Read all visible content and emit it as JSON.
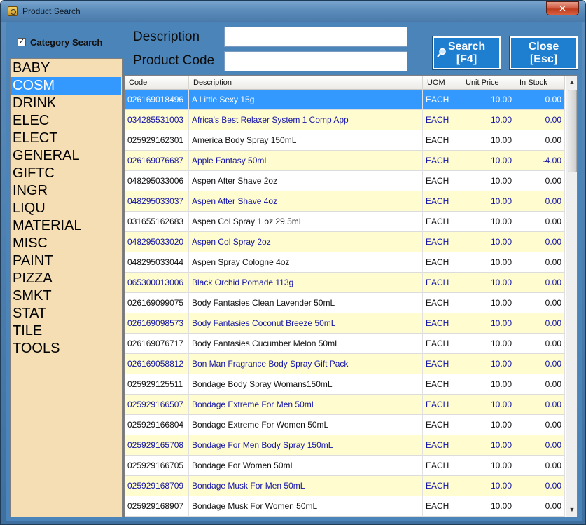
{
  "window": {
    "title": "Product Search",
    "close_glyph": "✕"
  },
  "category_search": {
    "label": "Category Search",
    "checked": true,
    "check_glyph": "✓"
  },
  "categories": [
    "BABY",
    "COSM",
    "DRINK",
    "ELEC",
    "ELECT",
    "GENERAL",
    "GIFTC",
    "INGR",
    "LIQU",
    "MATERIAL",
    "MISC",
    "PAINT",
    "PIZZA",
    "SMKT",
    "STAT",
    "TILE",
    "TOOLS"
  ],
  "selected_category": "COSM",
  "search": {
    "description_label": "Description",
    "description_value": "",
    "product_code_label": "Product Code",
    "product_code_value": ""
  },
  "buttons": {
    "search_line1": "Search",
    "search_line2": "[F4]",
    "close_line1": "Close",
    "close_line2": "[Esc]"
  },
  "grid": {
    "columns": [
      "Code",
      "Description",
      "UOM",
      "Unit Price",
      "In Stock"
    ],
    "rows": [
      [
        "026169018496",
        "A Little Sexy 15g",
        "EACH",
        "10.00",
        "0.00"
      ],
      [
        "034285531003",
        "Africa's Best Relaxer System 1 Comp App",
        "EACH",
        "10.00",
        "0.00"
      ],
      [
        "025929162301",
        "America Body Spray 150mL",
        "EACH",
        "10.00",
        "0.00"
      ],
      [
        "026169076687",
        "Apple Fantasy 50mL",
        "EACH",
        "10.00",
        "-4.00"
      ],
      [
        "048295033006",
        "Aspen After Shave 2oz",
        "EACH",
        "10.00",
        "0.00"
      ],
      [
        "048295033037",
        "Aspen After Shave 4oz",
        "EACH",
        "10.00",
        "0.00"
      ],
      [
        "031655162683",
        "Aspen Col Spray 1 oz 29.5mL",
        "EACH",
        "10.00",
        "0.00"
      ],
      [
        "048295033020",
        "Aspen Col Spray 2oz",
        "EACH",
        "10.00",
        "0.00"
      ],
      [
        "048295033044",
        "Aspen Spray Cologne 4oz",
        "EACH",
        "10.00",
        "0.00"
      ],
      [
        "065300013006",
        "Black Orchid Pomade 113g",
        "EACH",
        "10.00",
        "0.00"
      ],
      [
        "026169099075",
        "Body Fantasies Clean Lavender 50mL",
        "EACH",
        "10.00",
        "0.00"
      ],
      [
        "026169098573",
        "Body Fantasies Coconut Breeze 50mL",
        "EACH",
        "10.00",
        "0.00"
      ],
      [
        "026169076717",
        "Body Fantasies Cucumber Melon 50mL",
        "EACH",
        "10.00",
        "0.00"
      ],
      [
        "026169058812",
        "Bon Man Fragrance Body Spray Gift Pack",
        "EACH",
        "10.00",
        "0.00"
      ],
      [
        "025929125511",
        "Bondage Body Spray Womans150mL",
        "EACH",
        "10.00",
        "0.00"
      ],
      [
        "025929166507",
        "Bondage Extreme For Men 50mL",
        "EACH",
        "10.00",
        "0.00"
      ],
      [
        "025929166804",
        "Bondage Extreme For Women 50mL",
        "EACH",
        "10.00",
        "0.00"
      ],
      [
        "025929165708",
        "Bondage For Men Body Spray 150mL",
        "EACH",
        "10.00",
        "0.00"
      ],
      [
        "025929166705",
        "Bondage For Women 50mL",
        "EACH",
        "10.00",
        "0.00"
      ],
      [
        "025929168709",
        "Bondage Musk For Men 50mL",
        "EACH",
        "10.00",
        "0.00"
      ],
      [
        "025929168907",
        "Bondage Musk For Women 50mL",
        "EACH",
        "10.00",
        "0.00"
      ]
    ],
    "selected_row": 0
  },
  "scrollbar": {
    "up_glyph": "▲",
    "down_glyph": "▼"
  },
  "colors": {
    "selection": "#3399ff",
    "alt_row": "#fffdd0",
    "category_bg": "#f5deb3",
    "button": "#1e7fd0"
  }
}
